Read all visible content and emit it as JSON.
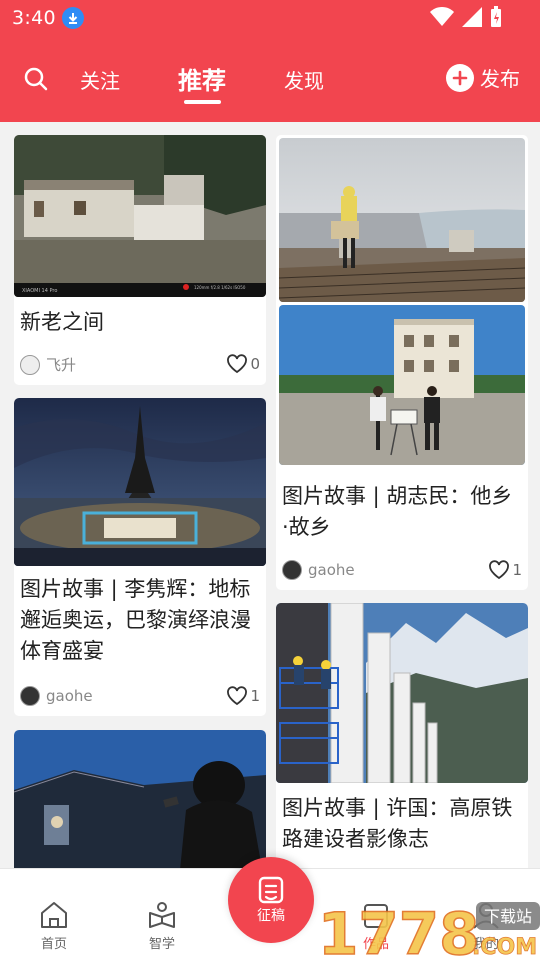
{
  "status": {
    "time": "3:40"
  },
  "header": {
    "tabs": [
      {
        "label": "关注"
      },
      {
        "label": "推荐"
      },
      {
        "label": "发现"
      }
    ],
    "publish_label": "发布",
    "accent_color": "#f2454f"
  },
  "feed": {
    "left": [
      {
        "title": "新老之间",
        "author": "飞升",
        "likes": "0"
      },
      {
        "title": "图片故事 | 李隽辉：地标邂逅奥运，巴黎演绎浪漫体育盛宴",
        "author": "gaohe",
        "likes": "1"
      },
      {
        "title": "",
        "author": "",
        "likes": ""
      }
    ],
    "right": [
      {
        "title": "图片故事 | 胡志民：他乡·故乡",
        "author": "gaohe",
        "likes": "1"
      },
      {
        "title": "图片故事 | 许国：高原铁路建设者影像志",
        "author": "",
        "likes": ""
      }
    ]
  },
  "bottom_nav": {
    "items": [
      {
        "label": "首页"
      },
      {
        "label": "智学"
      },
      {
        "label": "征稿"
      },
      {
        "label": "作品"
      },
      {
        "label": "我的"
      }
    ]
  },
  "watermark": {
    "text": "1778",
    "suffix": ".COM",
    "badge": "下载站"
  }
}
